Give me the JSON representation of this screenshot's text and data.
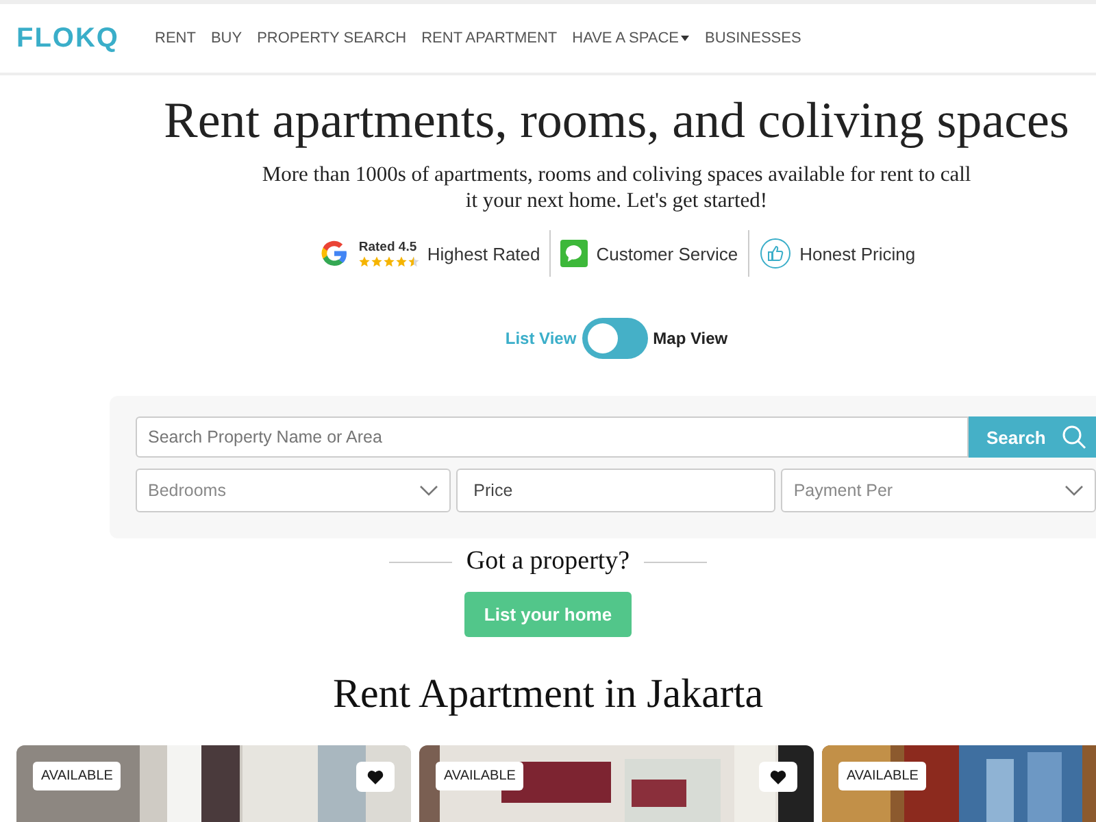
{
  "brand": "FLOKQ",
  "nav": [
    {
      "label": "RENT",
      "dropdown": false
    },
    {
      "label": "BUY",
      "dropdown": false
    },
    {
      "label": "PROPERTY SEARCH",
      "dropdown": false
    },
    {
      "label": "RENT APARTMENT",
      "dropdown": false
    },
    {
      "label": "HAVE A SPACE",
      "dropdown": true
    },
    {
      "label": "BUSINESSES",
      "dropdown": false
    }
  ],
  "hero": {
    "title": "Rent apartments, rooms, and coliving spaces",
    "subtitle": "More than 1000s of apartments, rooms and coliving spaces available for rent to call it your next home. Let's get started!"
  },
  "badges": [
    {
      "kind": "rating",
      "rating": "Rated 4.5",
      "stars": 4.5,
      "label": "Highest Rated"
    },
    {
      "kind": "chat",
      "label": "Customer Service"
    },
    {
      "kind": "thumb",
      "label": "Honest Pricing"
    }
  ],
  "view_toggle": {
    "left": "List View",
    "right": "Map View",
    "on": false
  },
  "search": {
    "placeholder": "Search Property Name or Area",
    "button": "Search",
    "filters": [
      {
        "kind": "select",
        "placeholder": "Bedrooms"
      },
      {
        "kind": "input",
        "placeholder": "Price"
      },
      {
        "kind": "select",
        "placeholder": "Payment Per"
      }
    ]
  },
  "cta": {
    "heading": "Got a property?",
    "button": "List your home"
  },
  "section_title": "Rent Apartment in Jakarta",
  "listings": [
    {
      "badge": "AVAILABLE"
    },
    {
      "badge": "AVAILABLE"
    },
    {
      "badge": "AVAILABLE"
    }
  ]
}
